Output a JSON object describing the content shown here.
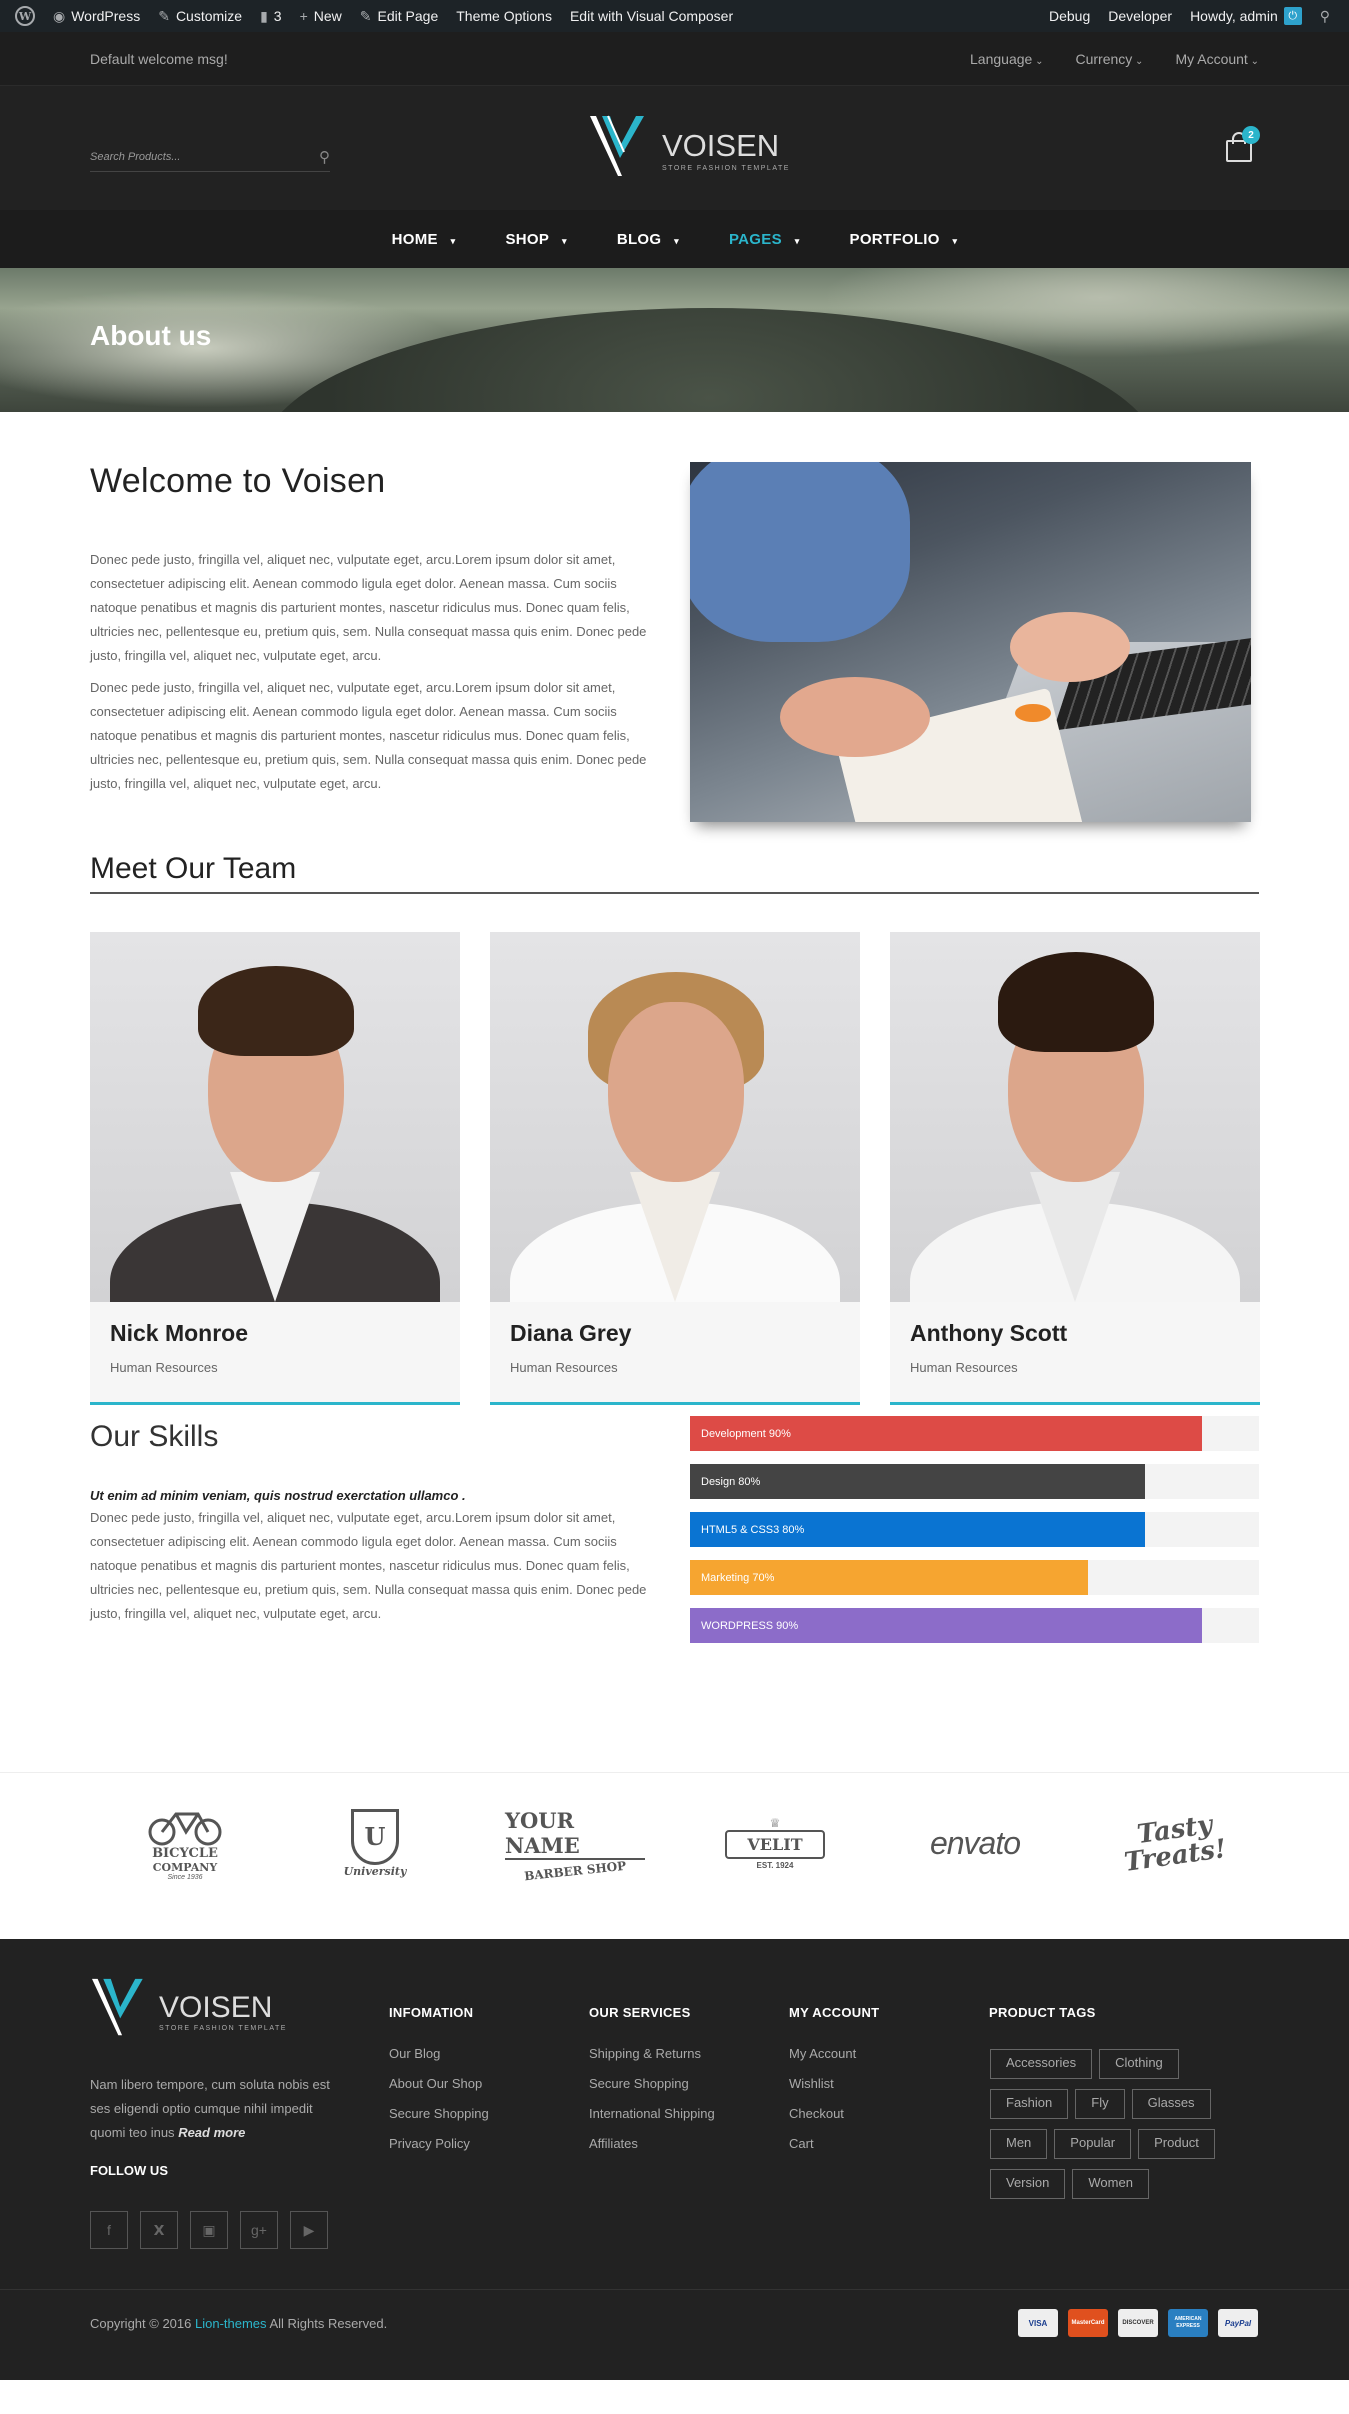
{
  "admin_bar": {
    "left": [
      "WordPress",
      "Customize",
      "3",
      "New",
      "Edit Page",
      "Theme Options",
      "Edit with Visual Composer"
    ],
    "right": [
      "Debug",
      "Developer",
      "Howdy, admin"
    ]
  },
  "topbar": {
    "welcome": "Default welcome msg!",
    "language": "Language",
    "currency": "Currency",
    "account": "My Account"
  },
  "header": {
    "search_placeholder": "Search Products...",
    "logo_name": "VOISEN",
    "logo_tagline": "STORE FASHION TEMPLATE",
    "cart_count": "2"
  },
  "nav": [
    "HOME",
    "SHOP",
    "BLOG",
    "PAGES",
    "PORTFOLIO"
  ],
  "nav_active": "PAGES",
  "banner": {
    "title": "About us"
  },
  "welcome": {
    "title": "Welcome to Voisen",
    "p1": "Donec pede justo, fringilla vel, aliquet nec, vulputate eget, arcu.Lorem ipsum dolor sit amet, consectetuer adipiscing elit. Aenean commodo ligula eget dolor. Aenean massa. Cum sociis natoque penatibus et magnis dis parturient montes, nascetur ridiculus mus. Donec quam felis, ultricies nec, pellentesque eu, pretium quis, sem. Nulla consequat massa quis enim. Donec pede justo, fringilla vel, aliquet nec, vulputate eget, arcu.",
    "p2": "Donec pede justo, fringilla vel, aliquet nec, vulputate eget, arcu.Lorem ipsum dolor sit amet, consectetuer adipiscing elit. Aenean commodo ligula eget dolor. Aenean massa. Cum sociis natoque penatibus et magnis dis parturient montes, nascetur ridiculus mus. Donec quam felis, ultricies nec, pellentesque eu, pretium quis, sem. Nulla consequat massa quis enim. Donec pede justo, fringilla vel, aliquet nec, vulputate eget, arcu."
  },
  "team": {
    "title": "Meet Our Team",
    "members": [
      {
        "name": "Nick Monroe",
        "role": "Human Resources"
      },
      {
        "name": "Diana Grey",
        "role": "Human Resources"
      },
      {
        "name": "Anthony Scott",
        "role": "Human Resources"
      }
    ]
  },
  "skills": {
    "title": "Our Skills",
    "quote": "Ut enim ad minim veniam, quis nostrud exerctation ullamco .",
    "text": "Donec pede justo, fringilla vel, aliquet nec, vulputate eget, arcu.Lorem ipsum dolor sit amet, consectetuer adipiscing elit. Aenean commodo ligula eget dolor. Aenean massa. Cum sociis natoque penatibus et magnis dis parturient montes, nascetur ridiculus mus. Donec quam felis, ultricies nec, pellentesque eu, pretium quis, sem. Nulla consequat massa quis enim. Donec pede justo, fringilla vel, aliquet nec, vulputate eget, arcu.",
    "bars": [
      {
        "label": "Development 90%",
        "value": 90,
        "color": "#dd4b46"
      },
      {
        "label": "Design 80%",
        "value": 80,
        "color": "#444444"
      },
      {
        "label": "HTML5 & CSS3 80%",
        "value": 80,
        "color": "#0a74d2"
      },
      {
        "label": "Marketing 70%",
        "value": 70,
        "color": "#f6a530"
      },
      {
        "label": "WORDPRESS 90%",
        "value": 90,
        "color": "#8c6cc9"
      }
    ]
  },
  "brands": {
    "bicycle": {
      "l1": "BICYCLE",
      "l2": "COMPANY",
      "l3": "Since 1936"
    },
    "university": {
      "l1": "U",
      "l2": "University"
    },
    "barber": {
      "l1": "YOUR NAME",
      "l2": "BARBER SHOP"
    },
    "velit": {
      "l1": "VELIT",
      "l2": "EST. 1924"
    },
    "envato": {
      "l1": "envato"
    },
    "tasty": {
      "l1": "Tasty",
      "l2": "Treats!"
    }
  },
  "footer": {
    "about": "Nam libero tempore, cum soluta nobis est ses eligendi optio cumque nihil impedit quomi teo inus",
    "read_more": "Read more",
    "follow": "FOLLOW US",
    "cols": [
      {
        "title": "INFOMATION",
        "items": [
          "Our Blog",
          "About Our Shop",
          "Secure Shopping",
          "Privacy Policy"
        ]
      },
      {
        "title": "OUR SERVICES",
        "items": [
          "Shipping & Returns",
          "Secure Shopping",
          "International Shipping",
          "Affiliates"
        ]
      },
      {
        "title": "MY ACCOUNT",
        "items": [
          "My Account",
          "Wishlist",
          "Checkout",
          "Cart"
        ]
      }
    ],
    "tags_title": "PRODUCT TAGS",
    "tags": [
      "Accessories",
      "Clothing",
      "Fashion",
      "Fly",
      "Glasses",
      "Men",
      "Popular",
      "Product",
      "Version",
      "Women"
    ],
    "copyright_pre": "Copyright © 2016",
    "copyright_link": "Lion-themes",
    "copyright_post": "All Rights Reserved.",
    "payments": [
      "VISA",
      "MasterCard",
      "DISCOVER",
      "AMERICAN EXPRESS",
      "PayPal"
    ]
  }
}
